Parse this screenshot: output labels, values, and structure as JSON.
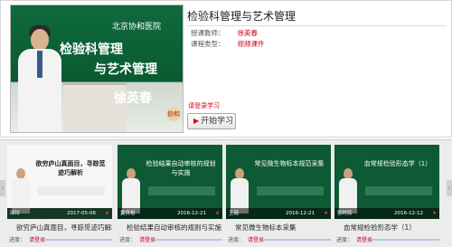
{
  "course": {
    "title": "检验科管理与艺术管理",
    "teacher_label": "授课教师：",
    "teacher_value": "徐英春",
    "type_label": "课程类型：",
    "type_value": "视频课件",
    "login_hint": "请登录学习",
    "start_button": "开始学习",
    "icon": "play-icon"
  },
  "main_video": {
    "hospital_logo": "北京协和医院",
    "slide_title_line1": "检验科管理",
    "slide_title_line2": "与艺术管理",
    "slide_author": "徐英春",
    "watermark": "协和"
  },
  "related": [
    {
      "title": "欲穷庐山真面目，寻踪觅迹巧解析",
      "who": "邱玲",
      "date": "2017-05-06",
      "fav": "★",
      "slide_text": "欲穷庐山真面目，寻踪觅迹巧解析",
      "progress_label": "进度：",
      "progress_value": "请登录",
      "progress": 0
    },
    {
      "title": "检验结果自动审核的规则与实施",
      "who": "夏良裕",
      "date": "2016-12-21",
      "fav": "★",
      "slide_text": "检验结果自动审核的规划与实施",
      "progress_label": "进度：",
      "progress_value": "请登录",
      "progress": 0
    },
    {
      "title": "常见微生物标本采集",
      "who": "王瑶",
      "date": "2016-12-21",
      "fav": "★",
      "slide_text": "常见微生物标本规范采集",
      "progress_label": "进度：",
      "progress_value": "请登录",
      "progress": 0
    },
    {
      "title": "血常规检验形态学（1）",
      "who": "张时民",
      "date": "2016-12-12",
      "fav": "★",
      "slide_text": "血常规检验形态学（1）",
      "progress_label": "进度：",
      "progress_value": "请登录",
      "progress": 0
    }
  ],
  "nav": {
    "prev": "‹",
    "next": "›"
  },
  "colors": {
    "accent_red": "#d0021b",
    "green": "#0d5a34"
  }
}
